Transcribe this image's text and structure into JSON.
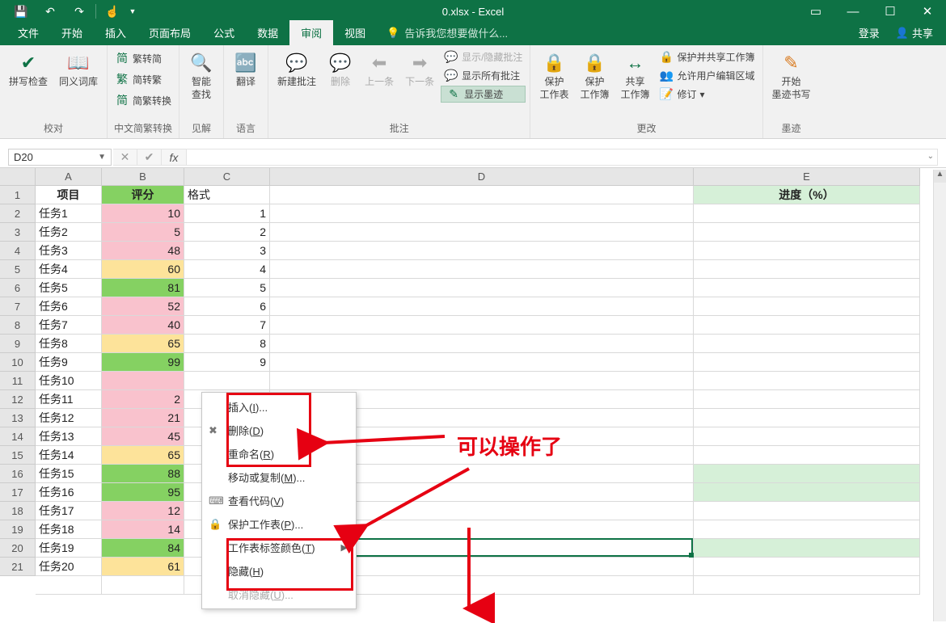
{
  "title": "0.xlsx - Excel",
  "tabs": {
    "file": "文件",
    "home": "开始",
    "insert": "插入",
    "layout": "页面布局",
    "formulas": "公式",
    "data": "数据",
    "review": "审阅",
    "view": "视图",
    "tellme": "告诉我您想要做什么...",
    "login": "登录",
    "share": "共享"
  },
  "ribbon": {
    "spellcheck": "拼写检查",
    "thesaurus": "同义词库",
    "proof_group": "校对",
    "fjt1": "繁转简",
    "fjt2": "简转繁",
    "fjt3": "简繁转换",
    "fjt_group": "中文简繁转换",
    "smart": "智能\n查找",
    "ins_group": "见解",
    "translate": "翻译",
    "lang_group": "语言",
    "new_comment": "新建批注",
    "delete": "删除",
    "prev": "上一条",
    "next": "下一条",
    "show_hide": "显示/隐藏批注",
    "show_all": "显示所有批注",
    "show_ink": "显示墨迹",
    "comments_group": "批注",
    "protect_sheet": "保护\n工作表",
    "protect_book": "保护\n工作簿",
    "share_book": "共享\n工作簿",
    "protect_share": "保护并共享工作簿",
    "allow_edit": "允许用户编辑区域",
    "track": "修订",
    "changes_group": "更改",
    "ink_start": "开始\n墨迹书写",
    "ink_group": "墨迹"
  },
  "namebox": "D20",
  "columns": [
    "A",
    "B",
    "C",
    "D",
    "E"
  ],
  "colwidths": {
    "A": 82,
    "B": 102,
    "C": 106,
    "D": 524,
    "E": 280
  },
  "headers": {
    "A": "项目",
    "B": "评分",
    "C": "格式",
    "E": "进度（%）"
  },
  "rows": [
    {
      "A": "任务1",
      "B": 10,
      "C": 1,
      "Bc": "pink"
    },
    {
      "A": "任务2",
      "B": 5,
      "C": 2,
      "Bc": "pink"
    },
    {
      "A": "任务3",
      "B": 48,
      "C": 3,
      "Bc": "pink"
    },
    {
      "A": "任务4",
      "B": 60,
      "C": 4,
      "Bc": "yellow"
    },
    {
      "A": "任务5",
      "B": 81,
      "C": 5,
      "Bc": "green"
    },
    {
      "A": "任务6",
      "B": 52,
      "C": 6,
      "Bc": "pink"
    },
    {
      "A": "任务7",
      "B": 40,
      "C": 7,
      "Bc": "pink"
    },
    {
      "A": "任务8",
      "B": 65,
      "C": 8,
      "Bc": "yellow"
    },
    {
      "A": "任务9",
      "B": 99,
      "C": 9,
      "Bc": "green"
    },
    {
      "A": "任务10",
      "B": "",
      "C": "",
      "Bc": "pink"
    },
    {
      "A": "任务11",
      "B": 2,
      "C": "",
      "Bc": "pink"
    },
    {
      "A": "任务12",
      "B": 21,
      "C": "",
      "Bc": "pink"
    },
    {
      "A": "任务13",
      "B": 45,
      "C": "",
      "Bc": "pink"
    },
    {
      "A": "任务14",
      "B": 65,
      "C": "",
      "Bc": "yellow"
    },
    {
      "A": "任务15",
      "B": 88,
      "C": "",
      "Bc": "green",
      "Ec": "ltgreen"
    },
    {
      "A": "任务16",
      "B": 95,
      "C": "",
      "Bc": "green",
      "Ec": "ltgreen"
    },
    {
      "A": "任务17",
      "B": 12,
      "C": "",
      "Bc": "pink"
    },
    {
      "A": "任务18",
      "B": 14,
      "C": "",
      "Bc": "pink"
    },
    {
      "A": "任务19",
      "B": 84,
      "C": "",
      "Bc": "green",
      "Ec": "ltgreen"
    },
    {
      "A": "任务20",
      "B": 61,
      "C": "",
      "Bc": "yellow"
    },
    {
      "A": "",
      "B": "",
      "C": "",
      "Bc": ""
    }
  ],
  "ctx": {
    "insert": "插入(I)...",
    "delete": "删除(D)",
    "rename": "重命名(R)",
    "movecopy": "移动或复制(M)...",
    "viewcode": "查看代码(V)",
    "protect": "保护工作表(P)...",
    "tabcolor": "工作表标签颜色(T)",
    "hide": "隐藏(H)",
    "unhide": "取消隐藏(U)..."
  },
  "annotation": "可以操作了"
}
